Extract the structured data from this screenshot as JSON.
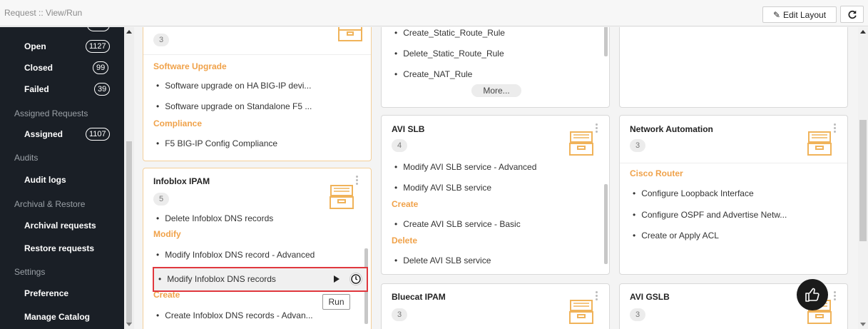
{
  "header": {
    "title": "Request :: View/Run",
    "edit_layout_label": "Edit Layout"
  },
  "sidebar": {
    "items": [
      {
        "label": "Open",
        "count": "1127"
      },
      {
        "label": "Closed",
        "count": "99"
      },
      {
        "label": "Failed",
        "count": "39"
      }
    ],
    "sections": [
      {
        "heading": "Assigned Requests",
        "items": [
          {
            "label": "Assigned",
            "count": "1107"
          }
        ]
      },
      {
        "heading": "Audits",
        "items": [
          {
            "label": "Audit logs"
          }
        ]
      },
      {
        "heading": "Archival & Restore",
        "items": [
          {
            "label": "Archival requests"
          },
          {
            "label": "Restore requests"
          }
        ]
      },
      {
        "heading": "Settings",
        "items": [
          {
            "label": "Preference"
          },
          {
            "label": "Manage Catalog"
          }
        ]
      }
    ]
  },
  "cards": {
    "f5": {
      "count": "3",
      "groups": [
        {
          "name": "Software Upgrade",
          "items": [
            "Software upgrade on HA BIG-IP devi...",
            "Software upgrade on Standalone F5 ..."
          ]
        },
        {
          "name": "Compliance",
          "items": [
            "F5 BIG-IP Config Compliance"
          ]
        }
      ]
    },
    "rules": {
      "items": [
        "Create_Static_Route_Rule",
        "Delete_Static_Route_Rule",
        "Create_NAT_Rule"
      ],
      "more_label": "More..."
    },
    "infoblox": {
      "title": "Infoblox IPAM",
      "count": "5",
      "items_top": [
        "Delete Infoblox DNS records"
      ],
      "group_modify": "Modify",
      "modify_items": [
        "Modify Infoblox DNS record - Advanced",
        "Modify Infoblox DNS records"
      ],
      "group_create": "Create",
      "create_items": [
        "Create Infoblox DNS records - Advan..."
      ],
      "tooltip": "Run"
    },
    "avi_slb": {
      "title": "AVI SLB",
      "count": "4",
      "items_top": [
        "Modify AVI SLB service - Advanced",
        "Modify AVI SLB service"
      ],
      "group_create": "Create",
      "create_items": [
        "Create AVI SLB service - Basic"
      ],
      "group_delete": "Delete",
      "delete_items": [
        "Delete AVI SLB service"
      ]
    },
    "network": {
      "title": "Network Automation",
      "count": "3",
      "group": "Cisco Router",
      "items": [
        "Configure Loopback Interface",
        "Configure OSPF and Advertise Netw...",
        "Create or Apply ACL"
      ]
    },
    "bluecat": {
      "title": "Bluecat IPAM",
      "count": "3"
    },
    "avi_gslb": {
      "title": "AVI GSLB",
      "count": "3"
    }
  },
  "colors": {
    "accent": "#f0a24a",
    "sidebar_bg": "#1a1f26",
    "highlight": "#e0383e"
  }
}
